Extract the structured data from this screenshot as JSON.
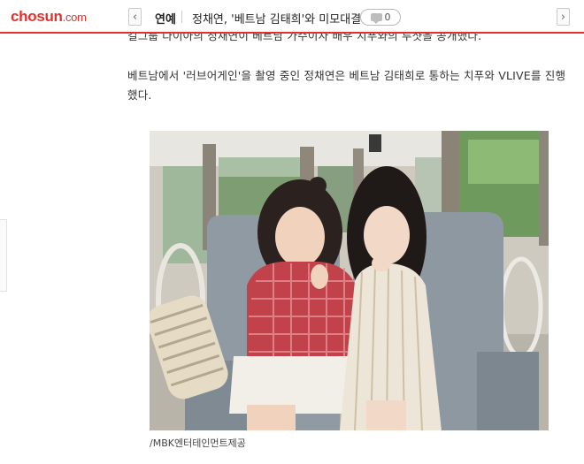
{
  "header": {
    "logo_text": "chosun",
    "logo_suffix": ".com",
    "prev_icon": "chevron-left-icon",
    "next_icon": "chevron-right-icon",
    "section": "연예",
    "headline": "정채연, '베트남 김태희'와 미모대결",
    "comment_count": "0",
    "accent_color": "#e3322c"
  },
  "article": {
    "para_1": "걸그룹 다이아의 정채연이 베트남 가수이자 배우 치푸와의 투샷을 공개했다.",
    "para_2": "베트남에서 '러브어게인'을 촬영 중인 정채연은 베트남 김태희로 통하는 치푸와 VLIVE를 진행했다.",
    "photo_caption": "/MBK엔터테인먼트제공"
  }
}
